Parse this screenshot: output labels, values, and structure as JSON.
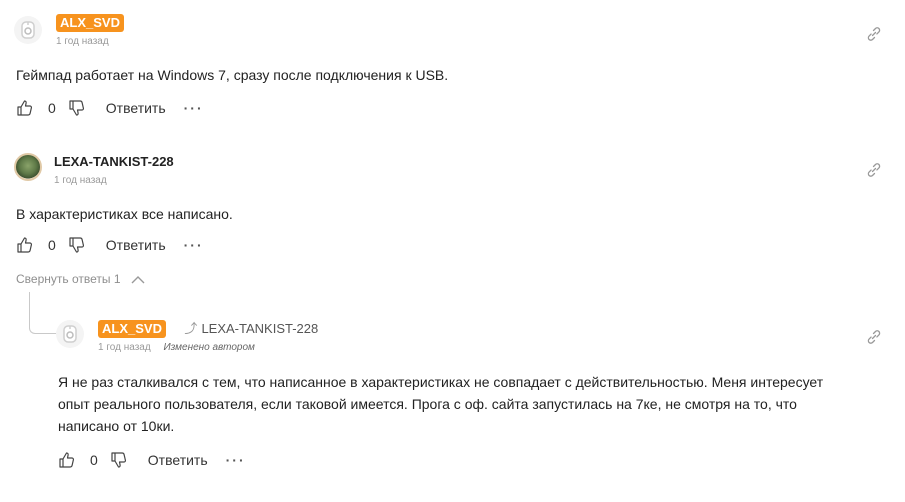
{
  "comments": [
    {
      "author": "ALX_SVD",
      "time": "1 год назад",
      "text": "Геймпад работает на Windows 7, сразу после подключения к USB.",
      "likes": "0",
      "reply_label": "Ответить",
      "more_label": "···"
    },
    {
      "author": "LEXA-TANKIST-228",
      "time": "1 год назад",
      "text": "В характеристиках все написано.",
      "likes": "0",
      "reply_label": "Ответить",
      "more_label": "···"
    }
  ],
  "collapse_label": "Свернуть ответы 1",
  "reply": {
    "author": "ALX_SVD",
    "reply_to": "LEXA-TANKIST-228",
    "time": "1 год назад",
    "edited": "Изменено автором",
    "text_line1": "Я не раз сталкивался с тем, что написанное в характеристиках не совпадает с действительностью. Меня интересует",
    "text_line2": "опыт реального пользователя, если таковой имеется.  Прога с оф. сайта запустилась на 7ке, не смотря на то, что",
    "text_line3": "написано от 10ки.",
    "likes": "0",
    "reply_label": "Ответить",
    "more_label": "···"
  },
  "icons": {
    "like": "thumbs-up-icon",
    "dislike": "thumbs-down-icon",
    "link": "link-icon",
    "collapse": "chevron-up-icon",
    "reply_arrow": "reply-arrow-icon"
  },
  "colors": {
    "badge": "#f7931e",
    "meta": "#9a9a9a"
  }
}
